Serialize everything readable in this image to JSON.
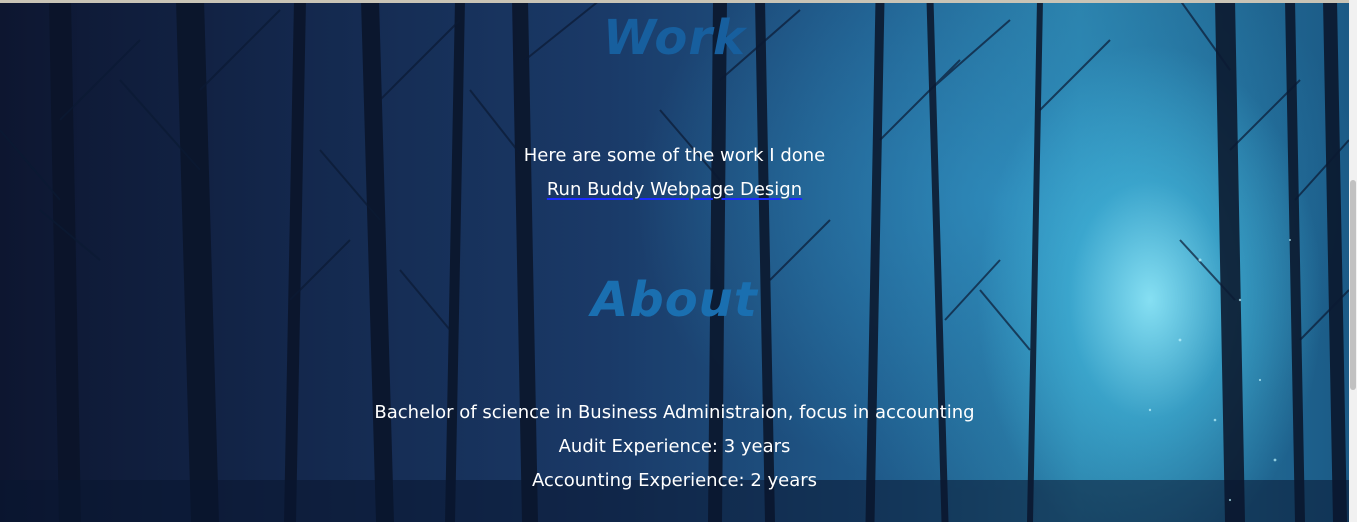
{
  "work": {
    "title": "Work",
    "intro": "Here are some of the work I done",
    "projects": [
      {
        "label": "Run Buddy Webpage Design"
      }
    ]
  },
  "about": {
    "title": "About",
    "lines": [
      "Bachelor of science in Business Administraion, focus in accounting",
      "Audit Experience: 3 years",
      "Accounting Experience: 2 years"
    ]
  },
  "colors": {
    "heading": "#1a6fb0",
    "text": "#ffffff",
    "link_underline": "#1a2bff"
  }
}
